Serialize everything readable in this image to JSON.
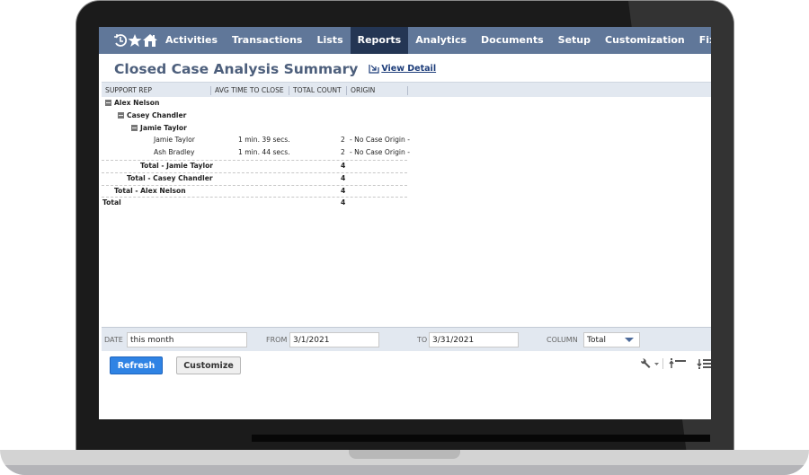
{
  "nav": {
    "icons": [
      "recent-records-icon",
      "favorites-star-icon",
      "home-icon"
    ],
    "items": [
      {
        "label": "Activities",
        "active": false
      },
      {
        "label": "Transactions",
        "active": false
      },
      {
        "label": "Lists",
        "active": false
      },
      {
        "label": "Reports",
        "active": true
      },
      {
        "label": "Analytics",
        "active": false
      },
      {
        "label": "Documents",
        "active": false
      },
      {
        "label": "Setup",
        "active": false
      },
      {
        "label": "Customization",
        "active": false
      },
      {
        "label": "Fix",
        "active": false
      }
    ]
  },
  "page": {
    "title": "Closed Case Analysis Summary",
    "view_detail_label": "View Detail"
  },
  "table": {
    "columns": [
      "SUPPORT REP",
      "AVG TIME TO CLOSE",
      "TOTAL COUNT",
      "ORIGIN"
    ],
    "rows": [
      {
        "type": "group",
        "level": 0,
        "label": "Alex Nelson"
      },
      {
        "type": "group",
        "level": 1,
        "label": "Casey Chandler"
      },
      {
        "type": "group",
        "level": 2,
        "label": "Jamie Taylor"
      },
      {
        "type": "detail",
        "rep": "Jamie Taylor",
        "avg_time": "1 min. 39 secs.",
        "count": "2",
        "origin": "- No Case Origin -"
      },
      {
        "type": "detail",
        "rep": "Ash Bradley",
        "avg_time": "1 min. 44 secs.",
        "count": "2",
        "origin": "- No Case Origin -"
      },
      {
        "type": "total",
        "level": 2,
        "label": "Total - Jamie Taylor",
        "count": "4"
      },
      {
        "type": "total",
        "level": 1,
        "label": "Total - Casey Chandler",
        "count": "4"
      },
      {
        "type": "total",
        "level": 0,
        "label": "Total - Alex Nelson",
        "count": "4"
      },
      {
        "type": "grand-total",
        "label": "Total",
        "count": "4"
      }
    ]
  },
  "filters": {
    "date_label": "DATE",
    "date_value": "this month",
    "from_label": "FROM",
    "from_value": "3/1/2021",
    "to_label": "TO",
    "to_value": "3/31/2021",
    "column_label": "COLUMN",
    "column_value": "Total"
  },
  "buttons": {
    "refresh": "Refresh",
    "customize": "Customize"
  },
  "colors": {
    "nav_bg": "#607799",
    "nav_active": "#243654",
    "title": "#4d5f7c",
    "refresh_button": "#2f83e4"
  }
}
